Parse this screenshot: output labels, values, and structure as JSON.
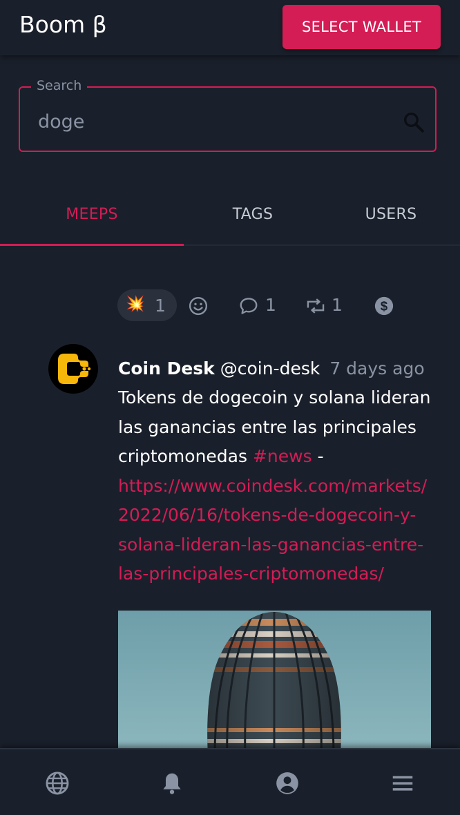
{
  "app": {
    "title": "Boom β"
  },
  "header": {
    "wallet_button_label": "SELECT WALLET"
  },
  "search": {
    "label": "Search",
    "value": "doge"
  },
  "tabs": [
    {
      "label": "MEEPS",
      "active": true
    },
    {
      "label": "TAGS",
      "active": false
    },
    {
      "label": "USERS",
      "active": false
    }
  ],
  "post": {
    "actions": {
      "boom_emoji": "💥",
      "boom_count": "1",
      "comments_count": "1",
      "rebooms_count": "1"
    },
    "author_name": "Coin Desk",
    "author_handle": "@coin-desk",
    "time_ago": "7 days ago",
    "text": "Tokens de dogecoin y solana lideran las ganancias entre las principales criptomonedas",
    "hashtag": "#news",
    "separator": " -",
    "url": "https://www.coindesk.com/markets/2022/06/16/tokens-de-dogecoin-y-solana-lideran-las-ganancias-entre-las-principales-criptomonedas/"
  },
  "bottom_nav": {
    "items": [
      {
        "icon": "globe-icon"
      },
      {
        "icon": "bell-icon"
      },
      {
        "icon": "account-icon"
      },
      {
        "icon": "menu-icon"
      }
    ]
  },
  "colors": {
    "background": "#1a202b",
    "accent": "#d41c55",
    "muted_text": "#8a93a3",
    "pill": "#2a313d"
  }
}
